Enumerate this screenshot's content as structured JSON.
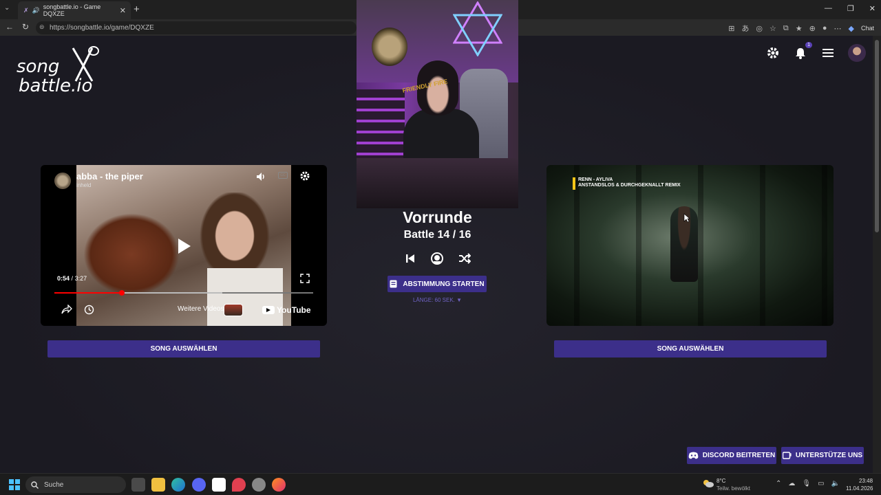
{
  "browser": {
    "tab_title": "songbattle.io - Game DQXZE",
    "url": "https://songbattle.io/game/DQXZE",
    "chat_label": "Chat",
    "new_tab_glyph": "+",
    "close_glyph": "✕"
  },
  "logo": {
    "line1": "song",
    "line2": "battle.io"
  },
  "header": {
    "notification_count": "1"
  },
  "left_video": {
    "title": "abba - the piper",
    "channel": "inheld",
    "time_current": "0:54",
    "time_separator": "/",
    "time_total": "3:27",
    "progress": 0.26,
    "buffered": 0.65,
    "more_videos_label": "Weitere Videos",
    "youtube_label": "YouTube",
    "cc_label": "CC"
  },
  "right_video": {
    "line1": "RENN - AYLIVA",
    "line2": "ANSTANDSLOS & DURCHGEKNALLT REMIX"
  },
  "select_buttons": {
    "left_label": "SONG AUSWÄHLEN",
    "right_label": "SONG AUSWÄHLEN"
  },
  "center": {
    "round_title": "Vorrunde",
    "battle_count": "Battle 14 / 16",
    "vote_button_label": "ABSTIMMUNG STARTEN",
    "length_label": "LÄNGE: 60 SEK. ▼"
  },
  "webcam": {
    "shirt_text": "FRIENDLY FIRE"
  },
  "bottom_buttons": {
    "discord_label": "DISCORD BEITRETEN",
    "support_label": "UNTERSTÜTZE UNS"
  },
  "taskbar": {
    "search_placeholder": "Suche",
    "weather_temp": "8°C",
    "weather_desc": "Teilw. bewölkt",
    "time": "23:48",
    "date": "11.04.2026"
  },
  "colors": {
    "accent": "#3c2f8a",
    "page_bg": "#1b1a22",
    "progress_red": "#ff0000",
    "length_text": "#6f62c4"
  }
}
